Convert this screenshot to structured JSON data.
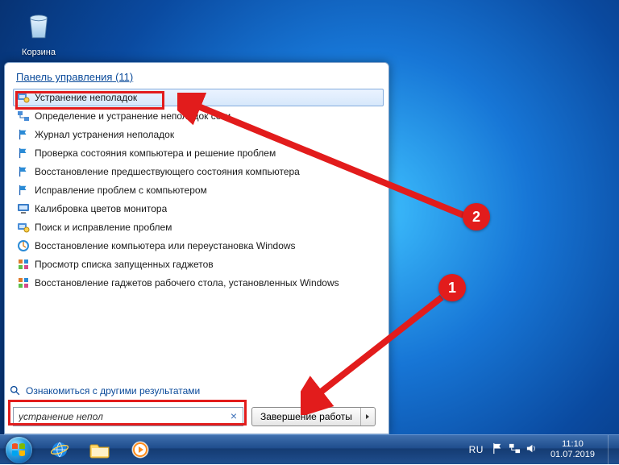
{
  "desktop": {
    "recycle_bin_label": "Корзина"
  },
  "start_menu": {
    "header_category": "Панель управления",
    "header_count": "(11)",
    "items": [
      {
        "label": "Устранение неполадок",
        "icon": "troubleshoot-icon",
        "selected": true
      },
      {
        "label": "Определение и устранение неполадок сети",
        "icon": "network-icon"
      },
      {
        "label": "Журнал устранения неполадок",
        "icon": "flag-icon"
      },
      {
        "label": "Проверка состояния компьютера и решение проблем",
        "icon": "flag-icon"
      },
      {
        "label": "Восстановление предшествующего состояния компьютера",
        "icon": "flag-icon"
      },
      {
        "label": "Исправление проблем с компьютером",
        "icon": "flag-icon"
      },
      {
        "label": "Калибровка цветов монитора",
        "icon": "monitor-icon"
      },
      {
        "label": "Поиск и исправление проблем",
        "icon": "troubleshoot-icon"
      },
      {
        "label": "Восстановление компьютера или переустановка Windows",
        "icon": "restore-icon"
      },
      {
        "label": "Просмотр списка запущенных гаджетов",
        "icon": "gadget-icon"
      },
      {
        "label": "Восстановление гаджетов рабочего стола, установленных Windows",
        "icon": "gadget-icon"
      }
    ],
    "more_results": "Ознакомиться с другими результатами",
    "search_value": "устранение непол",
    "search_clear": "×",
    "shutdown_label": "Завершение работы"
  },
  "annotations": {
    "badge1": "1",
    "badge2": "2"
  },
  "taskbar": {
    "lang": "RU",
    "time": "11:10",
    "date": "01.07.2019"
  }
}
